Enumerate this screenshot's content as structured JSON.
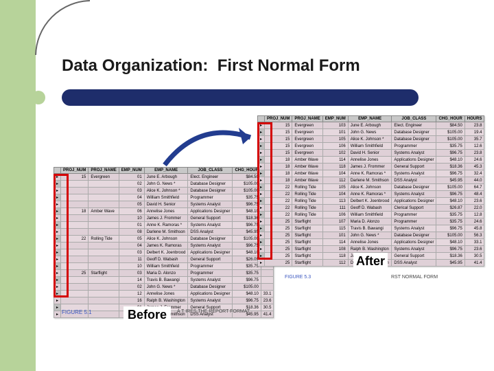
{
  "title": "Data Organization:  First Normal Form",
  "label_before": "Before",
  "label_after": "After",
  "caption_before_fig": "FIGURE 5.1",
  "caption_before_book": "A T           IRES THE REPORT FORMAT",
  "caption_after_fig": "FIGURE 5.3",
  "caption_after_book": "RST NORMAL FORM",
  "columns_before": [
    "PROJ_NUM",
    "PROJ_NAME",
    "EMP_NUM",
    "EMP_NAME",
    "JOB_CLASS",
    "CHG_HOUR",
    "HO"
  ],
  "columns_after": [
    "PROJ_NUM",
    "PROJ_NAME",
    "EMP_NUM",
    "EMP_NAME",
    "JOB_CLASS",
    "CHG_HOUR",
    "HOURS"
  ],
  "before_rows": [
    [
      "15",
      "Evergreen",
      "01",
      "June E. Arbough",
      "Elect. Engineer",
      "$84.50",
      ""
    ],
    [
      "",
      "",
      "02",
      "John G. News *",
      "Database Designer",
      "$105.00",
      ""
    ],
    [
      "",
      "",
      "03",
      "Alice K. Johnson *",
      "Database Designer",
      "$105.00",
      ""
    ],
    [
      "",
      "",
      "04",
      "William Smithfield",
      "Programmer",
      "$35.75",
      ""
    ],
    [
      "",
      "",
      "05",
      "David H. Senior",
      "Systems Analyst",
      "$96.75",
      ""
    ],
    [
      "18",
      "Amber Wave",
      "06",
      "Annelise Jones",
      "Applications Designer",
      "$48.10",
      ""
    ],
    [
      "",
      "",
      "10",
      "James J. Frommer",
      "General Support",
      "$18.36",
      ""
    ],
    [
      "",
      "",
      "01",
      "Anne K. Ramoras *",
      "Systems Analyst",
      "$96.75",
      ""
    ],
    [
      "",
      "",
      "08",
      "Darlene M. Smithson",
      "DSS Analyst",
      "$45.95",
      ""
    ],
    [
      "22",
      "Rolling Tide",
      "05",
      "Alice K. Johnson",
      "Database Designer",
      "$105.00",
      ""
    ],
    [
      "",
      "",
      "04",
      "James K. Ramoras",
      "Systems Analyst",
      "$96.75",
      ""
    ],
    [
      "",
      "",
      "03",
      "Delbert K. Joenbrood",
      "Applications Designer",
      "$48.10",
      ""
    ],
    [
      "",
      "",
      "11",
      "Geoff D. Wabash",
      "General Support",
      "$26.09",
      ""
    ],
    [
      "",
      "",
      "10",
      "William Smithfield",
      "Programmer",
      "$35.75",
      ""
    ],
    [
      "25",
      "Starflight",
      "03",
      "Maria D. Alonzo",
      "Programmer",
      "$35.75",
      ""
    ],
    [
      "",
      "",
      "14",
      "Travis B. Bawangi",
      "Systems Analyst",
      "$96.75",
      ""
    ],
    [
      "",
      "",
      "02",
      "John G. News *",
      "Database Designer",
      "$105.00",
      ""
    ],
    [
      "",
      "",
      "12",
      "Annelise Jones",
      "Applications Designer",
      "$48.10",
      "33.1"
    ],
    [
      "",
      "",
      "16",
      "Ralph B. Washington",
      "Systems Analyst",
      "$96.75",
      "23.6"
    ],
    [
      "",
      "",
      "01",
      "James J. Frommer",
      "General Support",
      "$18.36",
      "30.5"
    ],
    [
      "",
      "",
      "11",
      "Darlene M. Smithson",
      "DSS Analyst",
      "$45.95",
      "41.4"
    ]
  ],
  "after_rows": [
    [
      "15",
      "Evergreen",
      "103",
      "June E. Arbough",
      "Elect. Engineer",
      "$84.50",
      "23.8"
    ],
    [
      "15",
      "Evergreen",
      "101",
      "John G. News",
      "Database Designer",
      "$105.00",
      "19.4"
    ],
    [
      "15",
      "Evergreen",
      "105",
      "Alice K. Johnson *",
      "Database Designer",
      "$105.00",
      "35.7"
    ],
    [
      "15",
      "Evergreen",
      "106",
      "William Smithfield",
      "Programmer",
      "$35.75",
      "12.6"
    ],
    [
      "15",
      "Evergreen",
      "102",
      "David H. Senior",
      "Systems Analyst",
      "$96.75",
      "23.8"
    ],
    [
      "18",
      "Amber Wave",
      "114",
      "Annelise Jones",
      "Applications Designer",
      "$48.10",
      "24.6"
    ],
    [
      "18",
      "Amber Wave",
      "118",
      "James J. Frommer",
      "General Support",
      "$18.36",
      "45.3"
    ],
    [
      "18",
      "Amber Wave",
      "104",
      "Anne K. Ramoras *",
      "Systems Analyst",
      "$96.75",
      "32.4"
    ],
    [
      "18",
      "Amber Wave",
      "112",
      "Darlene M. Smithson",
      "DSS Analyst",
      "$45.95",
      "44.0"
    ],
    [
      "22",
      "Rolling Tide",
      "105",
      "Alice K. Johnson",
      "Database Designer",
      "$105.00",
      "64.7"
    ],
    [
      "22",
      "Rolling Tide",
      "104",
      "Anne K. Ramoras *",
      "Systems Analyst",
      "$96.75",
      "48.4"
    ],
    [
      "22",
      "Rolling Tide",
      "113",
      "Delbert K. Joenbrood",
      "Applications Designer",
      "$48.10",
      "23.6"
    ],
    [
      "22",
      "Rolling Tide",
      "111",
      "Geoff D. Wabash",
      "Clerical Support",
      "$26.87",
      "22.0"
    ],
    [
      "22",
      "Rolling Tide",
      "106",
      "William Smithfield",
      "Programmer",
      "$35.75",
      "12.8"
    ],
    [
      "25",
      "Starflight",
      "107",
      "Maria D. Alonzo",
      "Programmer",
      "$35.75",
      "24.6"
    ],
    [
      "25",
      "Starflight",
      "115",
      "Travis B. Bawangi",
      "Systems Analyst",
      "$96.75",
      "45.8"
    ],
    [
      "25",
      "Starflight",
      "101",
      "John G. News *",
      "Database Designer",
      "$105.00",
      "56.3"
    ],
    [
      "25",
      "Starflight",
      "114",
      "Annelise Jones",
      "Applications Designer",
      "$48.10",
      "33.1"
    ],
    [
      "25",
      "Starflight",
      "108",
      "Ralph B. Washington",
      "Systems Analyst",
      "$96.75",
      "23.6"
    ],
    [
      "25",
      "Starflight",
      "118",
      "James J. Frommer",
      "General Support",
      "$18.36",
      "30.5"
    ],
    [
      "25",
      "Starflight",
      "112",
      "Darlene M. Smithson",
      "DSS Analyst",
      "$45.95",
      "41.4"
    ]
  ]
}
